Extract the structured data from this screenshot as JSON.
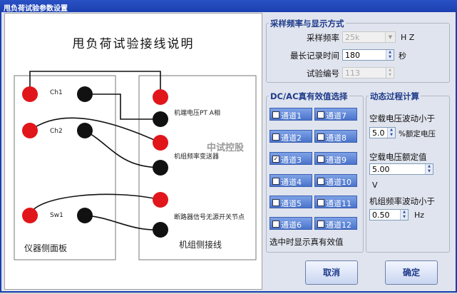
{
  "window": {
    "title": "甩负荷试验参数设置"
  },
  "diagram": {
    "title": "甩负荷试验接线说明",
    "left_panel_label": "仪器侧面板",
    "right_panel_label": "机组侧接线",
    "left_terminals": [
      "Ch1",
      "Ch2",
      "Sw1"
    ],
    "right_labels": [
      "机端电压PT A相",
      "机组频率变送器",
      "断路器信号无源开关节点"
    ],
    "watermark": "中试控股"
  },
  "sampling": {
    "title": "采样频率与显示方式",
    "rate_label": "采样频率",
    "rate_value": "25k",
    "rate_unit": "H Z",
    "max_time_label": "最长记录时间",
    "max_time_value": "180",
    "max_time_unit": "秒",
    "test_no_label": "试验编号",
    "test_no_value": "113"
  },
  "channels": {
    "title": "DC/AC真有效值选择",
    "items": [
      {
        "label": "通道1",
        "checked": false
      },
      {
        "label": "通道7",
        "checked": false
      },
      {
        "label": "通道2",
        "checked": false
      },
      {
        "label": "通道8",
        "checked": false
      },
      {
        "label": "通道3",
        "checked": true
      },
      {
        "label": "通道9",
        "checked": false
      },
      {
        "label": "通道4",
        "checked": false
      },
      {
        "label": "通道10",
        "checked": false
      },
      {
        "label": "通道5",
        "checked": false
      },
      {
        "label": "通道11",
        "checked": false
      },
      {
        "label": "通道6",
        "checked": false
      },
      {
        "label": "通道12",
        "checked": false
      }
    ],
    "footer": "选中时显示真有效值"
  },
  "dynamic": {
    "title": "动态过程计算",
    "voltage_label": "空载电压波动小于",
    "voltage_value": "5.0",
    "voltage_unit": "%额定电压",
    "rated_label": "空载电压额定值",
    "rated_value": "5.00",
    "rated_unit": "V",
    "freq_label": "机组频率波动小于",
    "freq_value": "0.50",
    "freq_unit": "Hz"
  },
  "buttons": {
    "cancel": "取消",
    "ok": "确定"
  }
}
